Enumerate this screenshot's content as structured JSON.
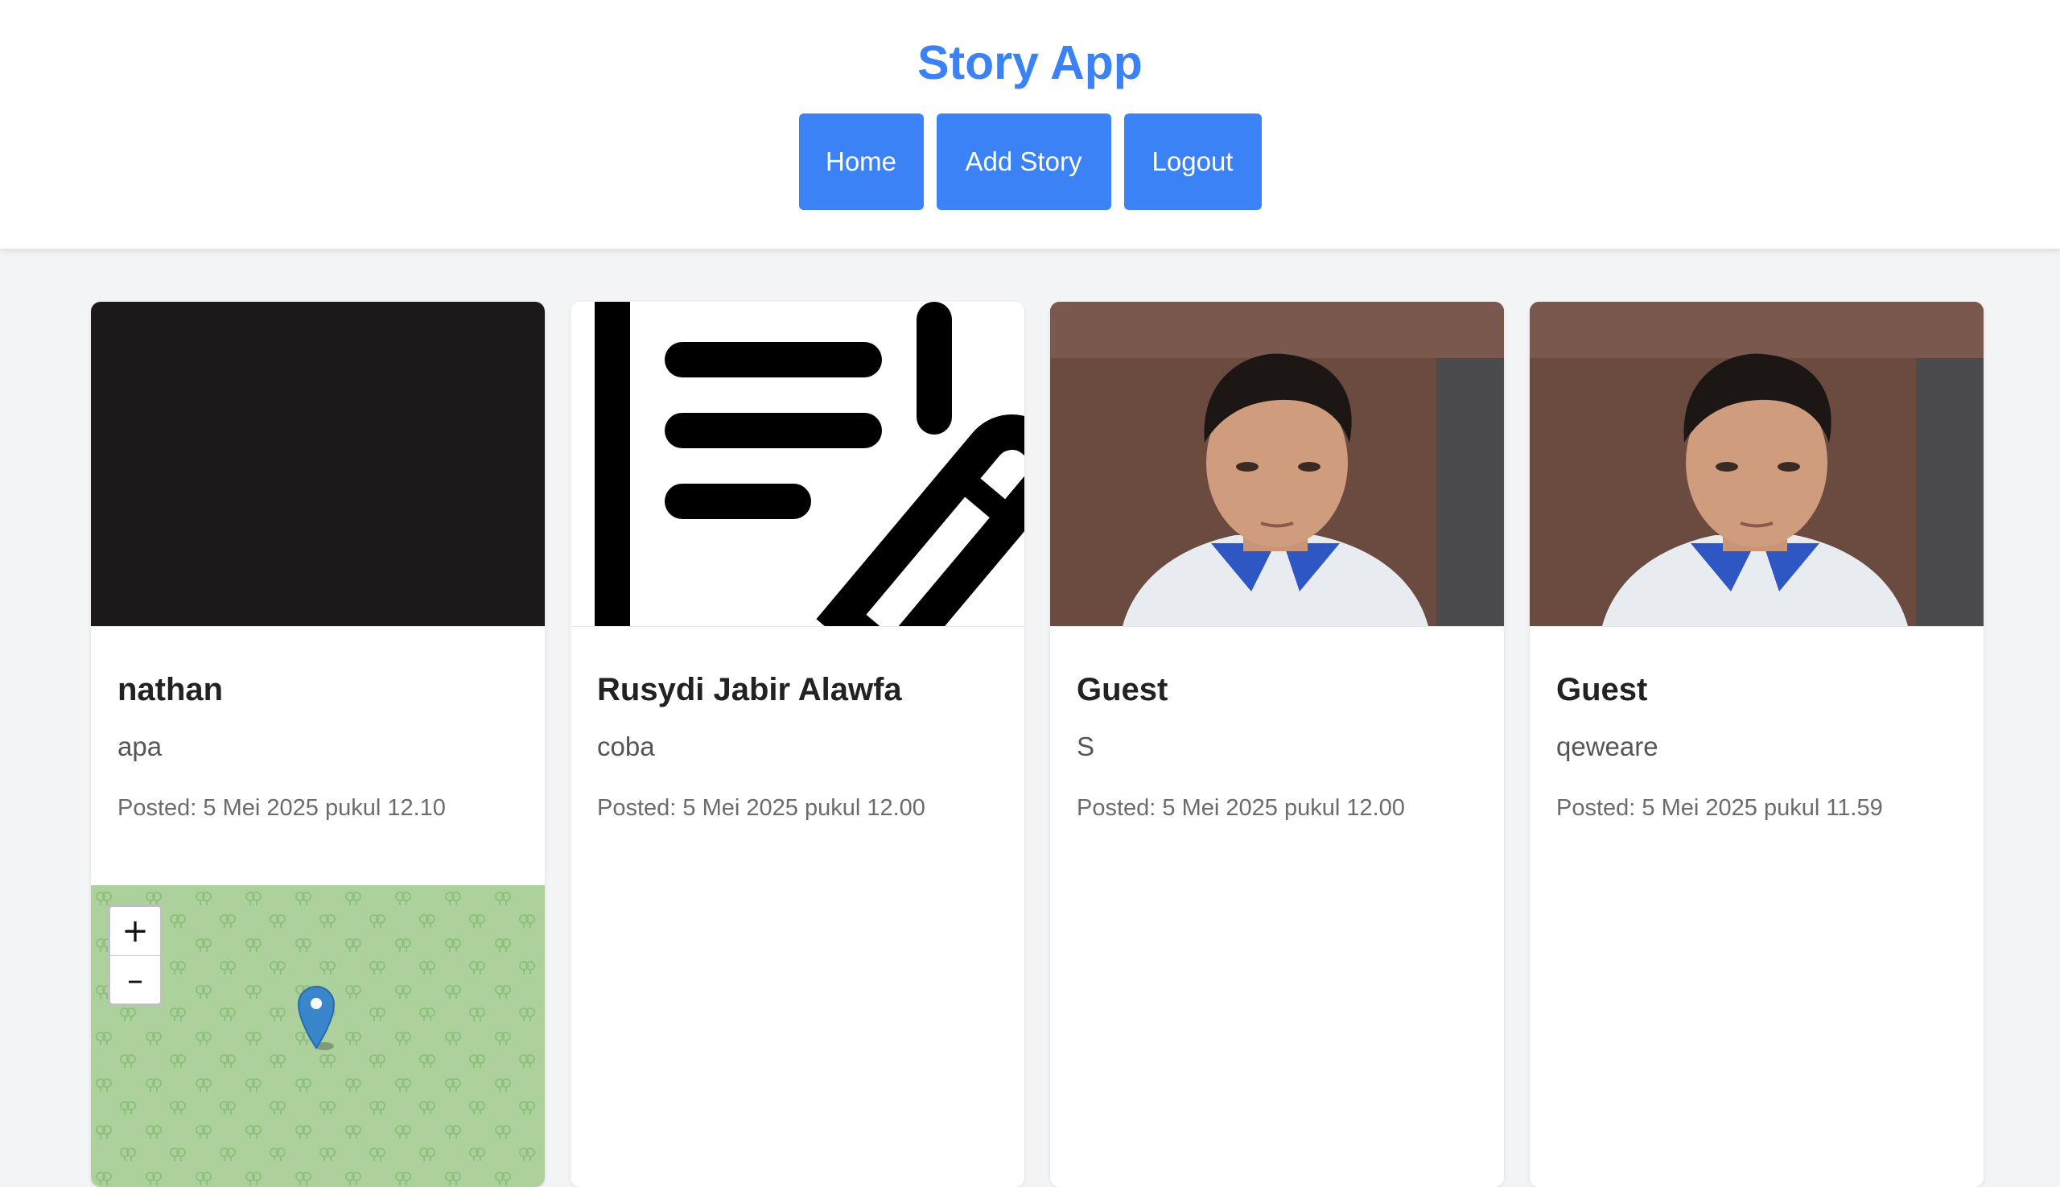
{
  "app": {
    "title": "Story App"
  },
  "nav": {
    "home": "Home",
    "add_story": "Add Story",
    "logout": "Logout"
  },
  "stories": [
    {
      "name": "nathan",
      "description": "apa",
      "posted": "Posted: 5 Mei 2025 pukul 12.10",
      "has_map": true
    },
    {
      "name": "Rusydi Jabir Alawfa",
      "description": "coba",
      "posted": "Posted: 5 Mei 2025 pukul 12.00",
      "has_map": false
    },
    {
      "name": "Guest",
      "description": "S",
      "posted": "Posted: 5 Mei 2025 pukul 12.00",
      "has_map": false
    },
    {
      "name": "Guest",
      "description": "qeweare",
      "posted": "Posted: 5 Mei 2025 pukul 11.59",
      "has_map": false
    }
  ],
  "map": {
    "zoom_in": "+",
    "zoom_out": "–",
    "marker_icon": "map-pin-icon"
  },
  "colors": {
    "accent": "#3b82f6",
    "map_bg": "#acd19d",
    "marker": "#3a86cc"
  }
}
